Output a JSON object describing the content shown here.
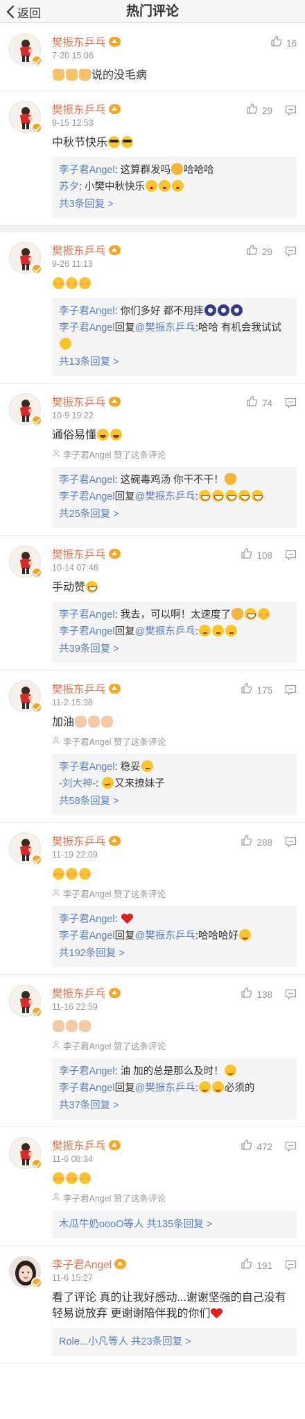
{
  "header": {
    "back_label": "返回",
    "title": "热门评论"
  },
  "comments": [
    {
      "author": "樊振东乒乓",
      "time": "7-20 15:06",
      "likes": "16",
      "show_reply_icon": false,
      "text_parts": [
        {
          "emoji": "thumb"
        },
        {
          "emoji": "thumb"
        },
        {
          "emoji": "thumb"
        },
        {
          "t": "说的没毛病"
        }
      ],
      "liked_by": "",
      "replies": [],
      "reply_total": ""
    },
    {
      "author": "樊振东乒乓",
      "time": "9-15 12:53",
      "likes": "29",
      "show_reply_icon": true,
      "text_parts": [
        {
          "t": "中秋节快乐"
        },
        {
          "emoji": "cool"
        },
        {
          "emoji": "cool"
        }
      ],
      "liked_by": "",
      "replies": [
        [
          {
            "name": "李子君Angel"
          },
          {
            "t": ": 这算群发吗"
          },
          {
            "emoji": "cat"
          },
          {
            "t": "哈哈哈"
          }
        ],
        [
          {
            "name": "苏夕"
          },
          {
            "t": ": 小樊中秋快乐"
          },
          {
            "emoji": "shy"
          },
          {
            "emoji": "shy"
          },
          {
            "emoji": "shy"
          }
        ]
      ],
      "reply_total": "共3条回复 >"
    },
    {
      "author": "樊振东乒乓",
      "time": "9-26 11:13",
      "likes": "29",
      "show_reply_icon": true,
      "gap_before": true,
      "text_parts": [
        {
          "emoji": "blush"
        },
        {
          "emoji": "blush"
        },
        {
          "emoji": "blush"
        }
      ],
      "liked_by": "",
      "replies": [
        [
          {
            "name": "李子君Angel"
          },
          {
            "t": ": 你们多好 都不用摔"
          },
          {
            "emoji": "shock"
          },
          {
            "emoji": "shock"
          },
          {
            "emoji": "shock"
          }
        ],
        [
          {
            "name": "李子君Angel"
          },
          {
            "t": "回复"
          },
          {
            "name": "@樊振东乒乓"
          },
          {
            "t": ":哈哈 有机会我试试"
          },
          {
            "emoji": "sun"
          }
        ]
      ],
      "reply_total": "共13条回复 >"
    },
    {
      "author": "樊振东乒乓",
      "time": "10-9 19:22",
      "likes": "74",
      "show_reply_icon": true,
      "text_parts": [
        {
          "t": "通俗易懂"
        },
        {
          "emoji": "grin"
        },
        {
          "emoji": "grin"
        }
      ],
      "liked_by": "李子君Angel 赞了这条评论",
      "replies": [
        [
          {
            "name": "李子君Angel"
          },
          {
            "t": ": 这碗毒鸡汤 你干不干！"
          },
          {
            "emoji": "cat"
          }
        ],
        [
          {
            "name": "李子君Angel"
          },
          {
            "t": "回复"
          },
          {
            "name": "@樊振东乒乓"
          },
          {
            "t": ":"
          },
          {
            "emoji": "laugh"
          },
          {
            "emoji": "laugh"
          },
          {
            "emoji": "laugh"
          },
          {
            "emoji": "laugh"
          },
          {
            "emoji": "laugh"
          }
        ]
      ],
      "reply_total": "共25条回复 >"
    },
    {
      "author": "樊振东乒乓",
      "time": "10-14 07:46",
      "likes": "108",
      "show_reply_icon": true,
      "text_parts": [
        {
          "t": "手动赞"
        },
        {
          "emoji": "laugh"
        }
      ],
      "liked_by": "",
      "replies": [
        [
          {
            "name": "李子君Angel"
          },
          {
            "t": ": 我去，可以啊！太速度了"
          },
          {
            "emoji": "cat"
          },
          {
            "emoji": "laugh"
          },
          {
            "emoji": "blush"
          }
        ],
        [
          {
            "name": "李子君Angel"
          },
          {
            "t": "回复"
          },
          {
            "name": "@樊振东乒乓"
          },
          {
            "t": ":"
          },
          {
            "emoji": "think"
          },
          {
            "emoji": "think"
          },
          {
            "emoji": "think"
          }
        ]
      ],
      "reply_total": "共39条回复 >"
    },
    {
      "author": "樊振东乒乓",
      "time": "11-2 15:38",
      "likes": "175",
      "show_reply_icon": true,
      "text_parts": [
        {
          "t": "加油"
        },
        {
          "emoji": "fist"
        },
        {
          "emoji": "fist"
        },
        {
          "emoji": "fist"
        }
      ],
      "liked_by": "李子君Angel 赞了这条评论",
      "replies": [
        [
          {
            "name": "李子君Angel"
          },
          {
            "t": ": 稳妥"
          },
          {
            "emoji": "think"
          }
        ],
        [
          {
            "name": "-刘大神-"
          },
          {
            "t": ": "
          },
          {
            "emoji": "sly"
          },
          {
            "t": "又来撩妹子"
          }
        ]
      ],
      "reply_total": "共58条回复 >"
    },
    {
      "author": "樊振东乒乓",
      "time": "11-19 22:09",
      "likes": "288",
      "show_reply_icon": true,
      "text_parts": [
        {
          "emoji": "blush"
        },
        {
          "emoji": "blush"
        },
        {
          "emoji": "blush"
        }
      ],
      "liked_by": "李子君Angel 赞了这条评论",
      "replies": [
        [
          {
            "name": "李子君Angel"
          },
          {
            "t": ": "
          },
          {
            "emoji": "heart"
          }
        ],
        [
          {
            "name": "李子君Angel"
          },
          {
            "t": "回复"
          },
          {
            "name": "@樊振东乒乓"
          },
          {
            "t": ":哈哈哈好"
          },
          {
            "emoji": "smile"
          }
        ]
      ],
      "reply_total": "共192条回复 >"
    },
    {
      "author": "樊振东乒乓",
      "time": "11-16 22:59",
      "likes": "138",
      "show_reply_icon": true,
      "text_parts": [
        {
          "emoji": "fist"
        },
        {
          "emoji": "fist"
        },
        {
          "emoji": "fist"
        }
      ],
      "liked_by": "李子君Angel 赞了这条评论",
      "replies": [
        [
          {
            "name": "李子君Angel"
          },
          {
            "t": ": 油 加的总是那么及时！"
          },
          {
            "emoji": "smile"
          }
        ],
        [
          {
            "name": "李子君Angel"
          },
          {
            "t": "回复"
          },
          {
            "name": "@樊振东乒乓"
          },
          {
            "t": ":"
          },
          {
            "emoji": "smile"
          },
          {
            "emoji": "smile"
          },
          {
            "t": "必须的"
          }
        ]
      ],
      "reply_total": "共37条回复 >"
    },
    {
      "author": "樊振东乒乓",
      "time": "11-6 08:34",
      "likes": "472",
      "show_reply_icon": true,
      "text_parts": [
        {
          "emoji": "blush"
        },
        {
          "emoji": "blush"
        },
        {
          "emoji": "blush"
        }
      ],
      "liked_by": "李子君Angel 赞了这条评论",
      "replies": [],
      "reply_total_inline": "木瓜牛奶oooO等人 共135条回复 >",
      "reply_total": ""
    },
    {
      "author": "李子君Angel",
      "time": "11-6 15:27",
      "likes": "191",
      "show_reply_icon": true,
      "avatar": "girl",
      "text_parts": [
        {
          "t": "看了评论 真的让我好感动...谢谢坚强的自己没有轻易说放弃 更谢谢陪伴我的你们"
        },
        {
          "emoji": "heart"
        }
      ],
      "liked_by": "",
      "replies": [],
      "reply_total_inline": "Role...小凡等人 共23条回复 >",
      "reply_total": ""
    }
  ]
}
